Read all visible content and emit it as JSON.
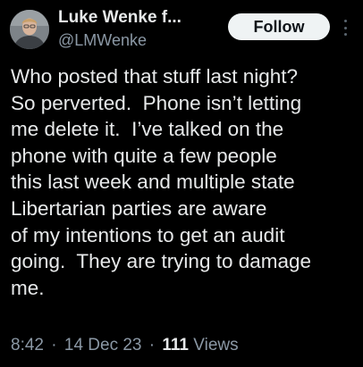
{
  "author": {
    "display_name": "Luke Wenke f...",
    "handle": "@LMWenke"
  },
  "actions": {
    "follow_label": "Follow"
  },
  "tweet": {
    "lines": [
      "Who posted that stuff last night?",
      "So perverted.  Phone isn’t letting",
      "me delete it.  I’ve talked on the",
      "phone with quite a few people",
      "this last week and multiple state",
      "Libertarian parties are aware",
      "of my intentions to get an audit",
      "going.  They are trying to damage",
      "me."
    ]
  },
  "meta": {
    "time": "8:42",
    "separator": "·",
    "date": "14 Dec 23",
    "views_count": "111",
    "views_label": "Views"
  },
  "icons": {
    "avatar": "avatar-portrait",
    "more": "more-vertical-icon"
  },
  "colors": {
    "background": "#000000",
    "text": "#e7e9ea",
    "secondary_text": "#8b98a5",
    "follow_button_bg": "#eff3f4",
    "follow_button_text": "#0f1419"
  }
}
